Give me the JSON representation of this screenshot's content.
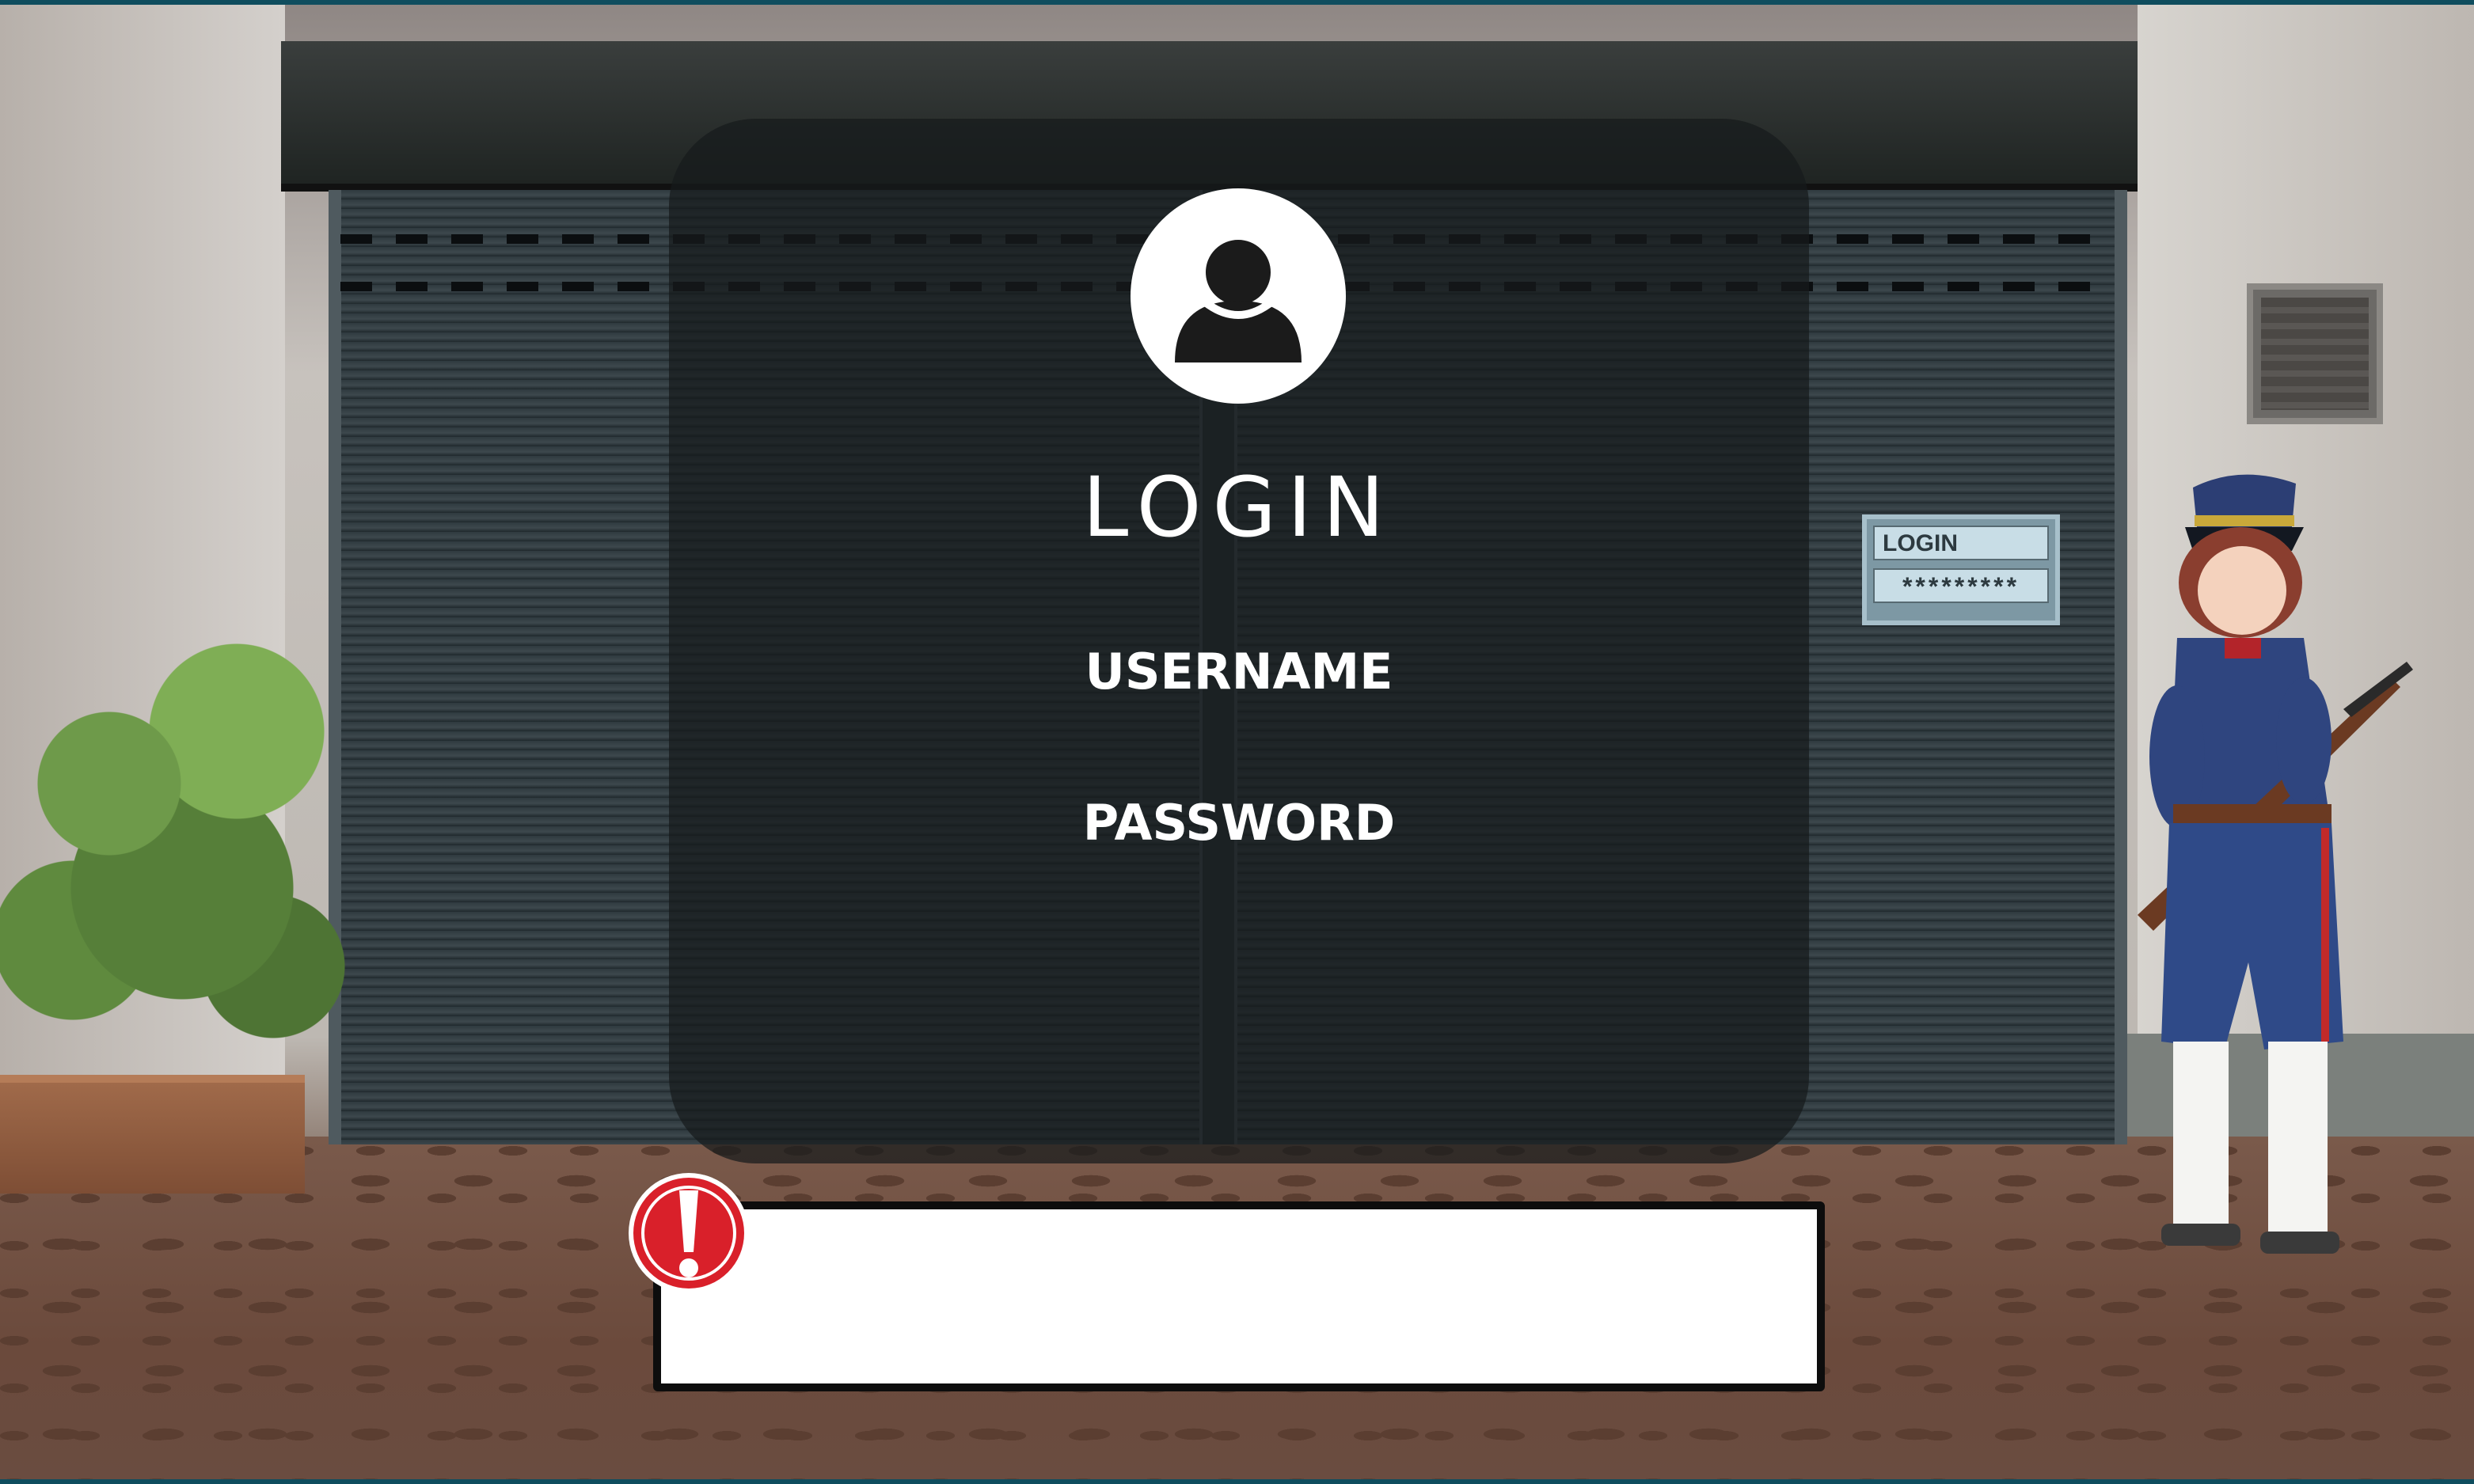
{
  "login_panel": {
    "title": "LOGIN",
    "username_label": "USERNAME",
    "password_label": "PASSWORD",
    "username_value": "",
    "password_value": "",
    "avatar_icon": "user-icon"
  },
  "message_box": {
    "text": "",
    "icon": "alert-icon",
    "icon_color": "#d9202a"
  },
  "scene_sign": {
    "field_label": "LOGIN",
    "masked_value": "*********"
  },
  "colors": {
    "panel": "#161a1c",
    "text": "#ffffff",
    "frame_border": "#0f4d5e"
  }
}
